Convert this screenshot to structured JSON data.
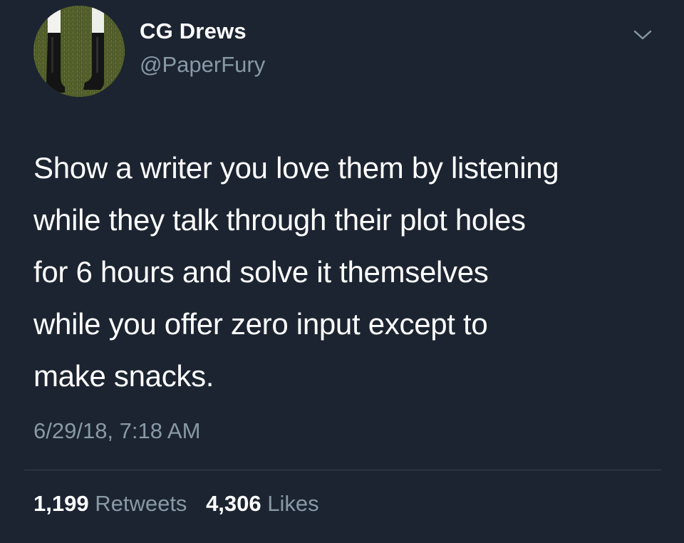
{
  "author": {
    "display_name": "CG Drews",
    "handle": "@PaperFury",
    "avatar_icon": "profile-photo-boots-on-grass"
  },
  "menu": {
    "icon": "chevron-down-icon"
  },
  "tweet": {
    "text_lines": [
      "Show a writer you love them by listening",
      "while they talk through their plot holes",
      "for 6 hours and solve it themselves",
      "while you offer zero input except to",
      "make snacks."
    ],
    "timestamp": "6/29/18, 7:18 AM"
  },
  "stats": {
    "retweets_count": "1,199",
    "retweets_label": "Retweets",
    "likes_count": "4,306",
    "likes_label": "Likes"
  },
  "colors": {
    "background": "#1c2431",
    "primary_text": "#ffffff",
    "secondary_text": "#8899a6",
    "divider": "#38444d"
  }
}
